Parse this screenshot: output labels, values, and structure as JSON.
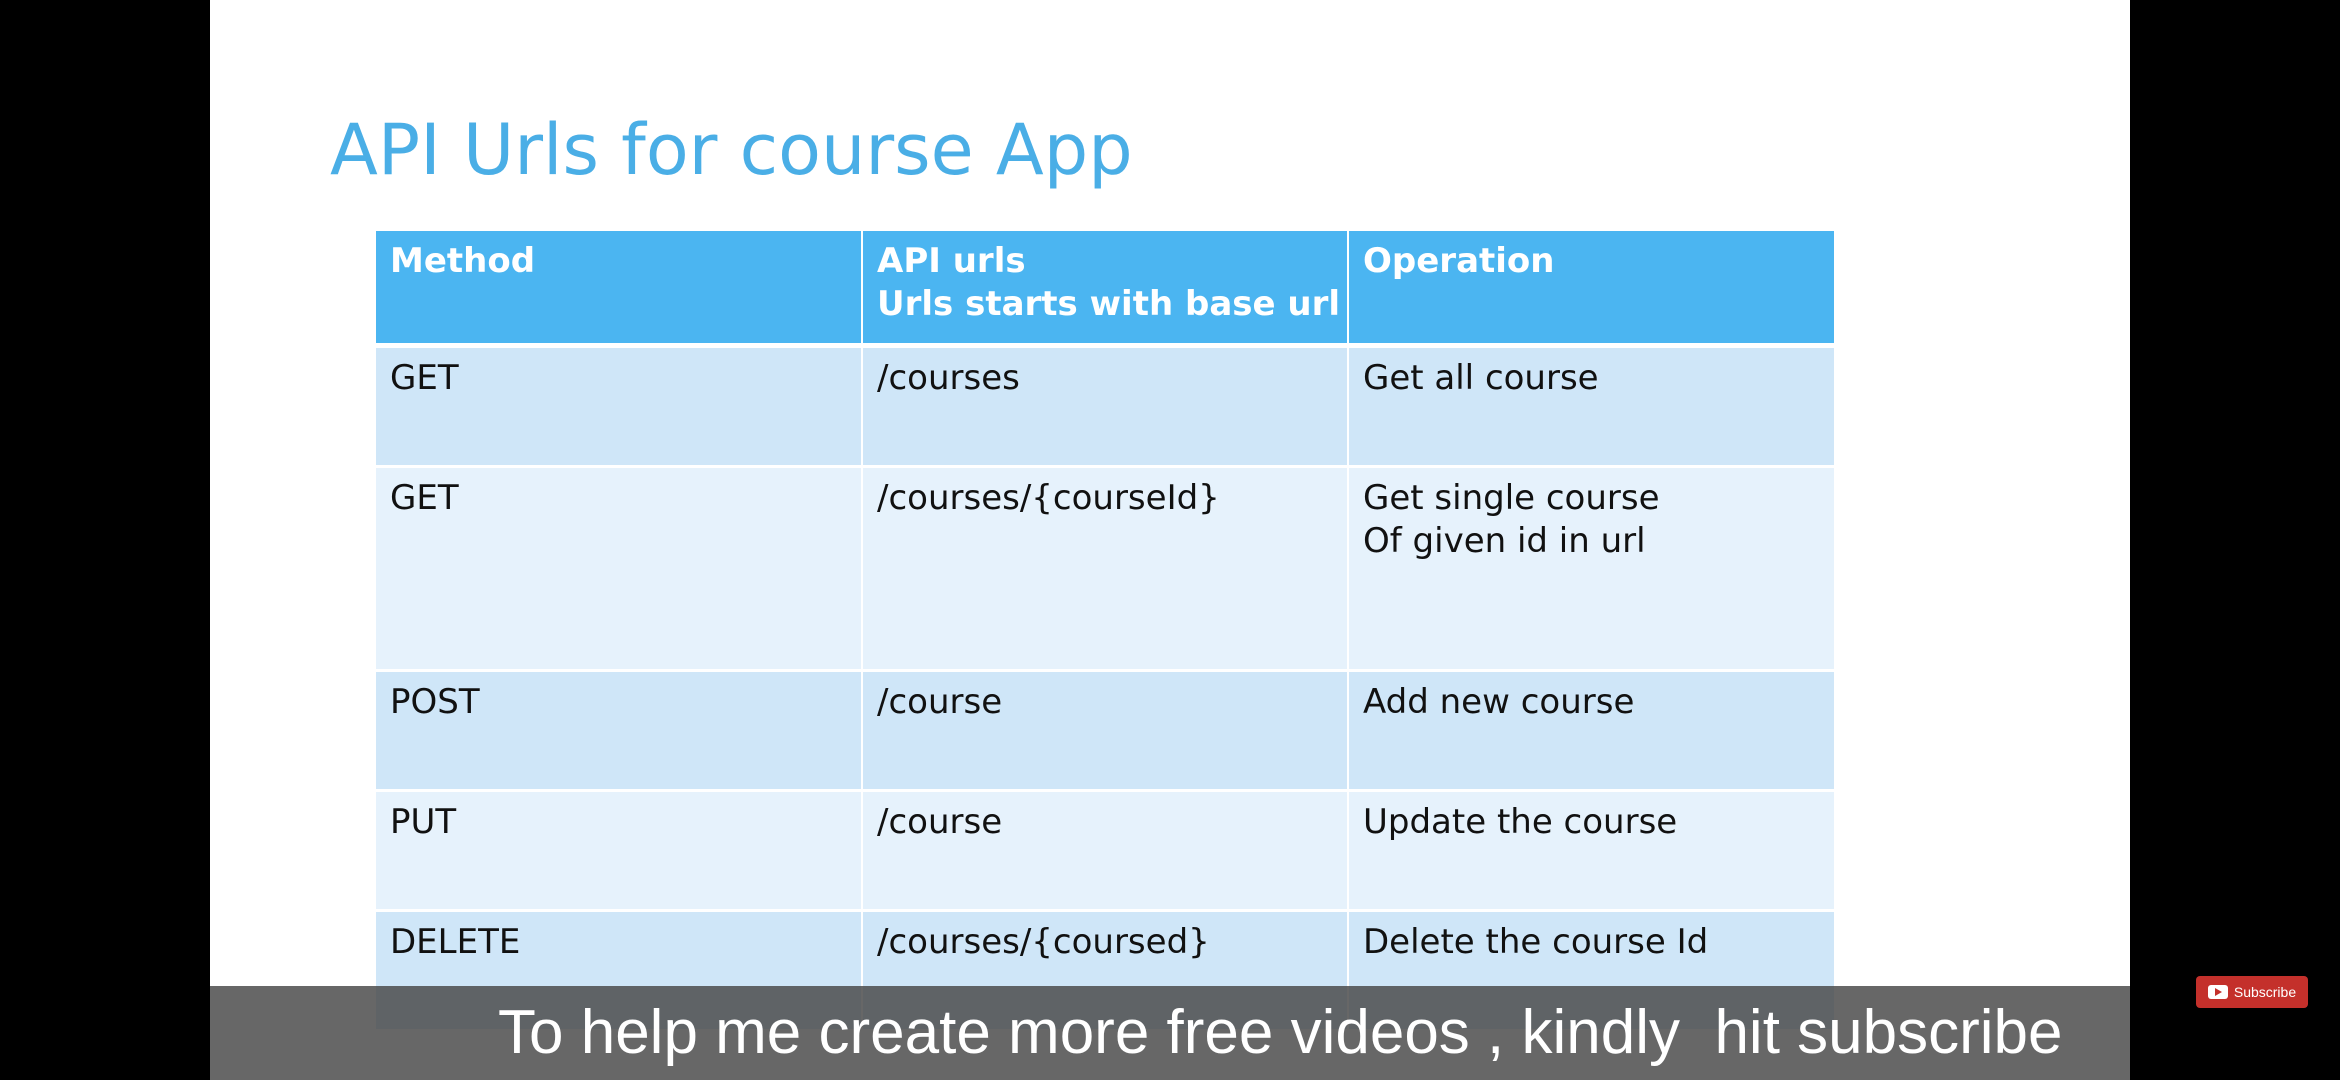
{
  "slide": {
    "title": "API Urls for course App",
    "table": {
      "headers": [
        [
          "Method"
        ],
        [
          "API urls",
          "Urls starts with base url"
        ],
        [
          "Operation"
        ]
      ],
      "rows": [
        {
          "method": "GET",
          "url": "/courses",
          "operation": [
            "Get all course"
          ]
        },
        {
          "method": "GET",
          "url": "/courses/{courseId}",
          "operation": [
            "Get single course",
            "Of given id in url"
          ]
        },
        {
          "method": "POST",
          "url": "/course",
          "operation": [
            "Add new course"
          ]
        },
        {
          "method": "PUT",
          "url": "/course",
          "operation": [
            "Update the course"
          ]
        },
        {
          "method": "DELETE",
          "url": "/courses/{coursed}",
          "operation": [
            "Delete the course Id"
          ]
        }
      ]
    }
  },
  "overlay": {
    "subtitle": "To help me create more free videos , kindly  hit subscribe",
    "subscribe_button": {
      "label": "Subscribe",
      "icon": "youtube-play-icon",
      "color": "#c4302b"
    }
  },
  "colors": {
    "title": "#4aaee6",
    "header_bg": "#4bb5f1",
    "row_odd": "#cfe6f8",
    "row_even": "#e6f2fc"
  }
}
